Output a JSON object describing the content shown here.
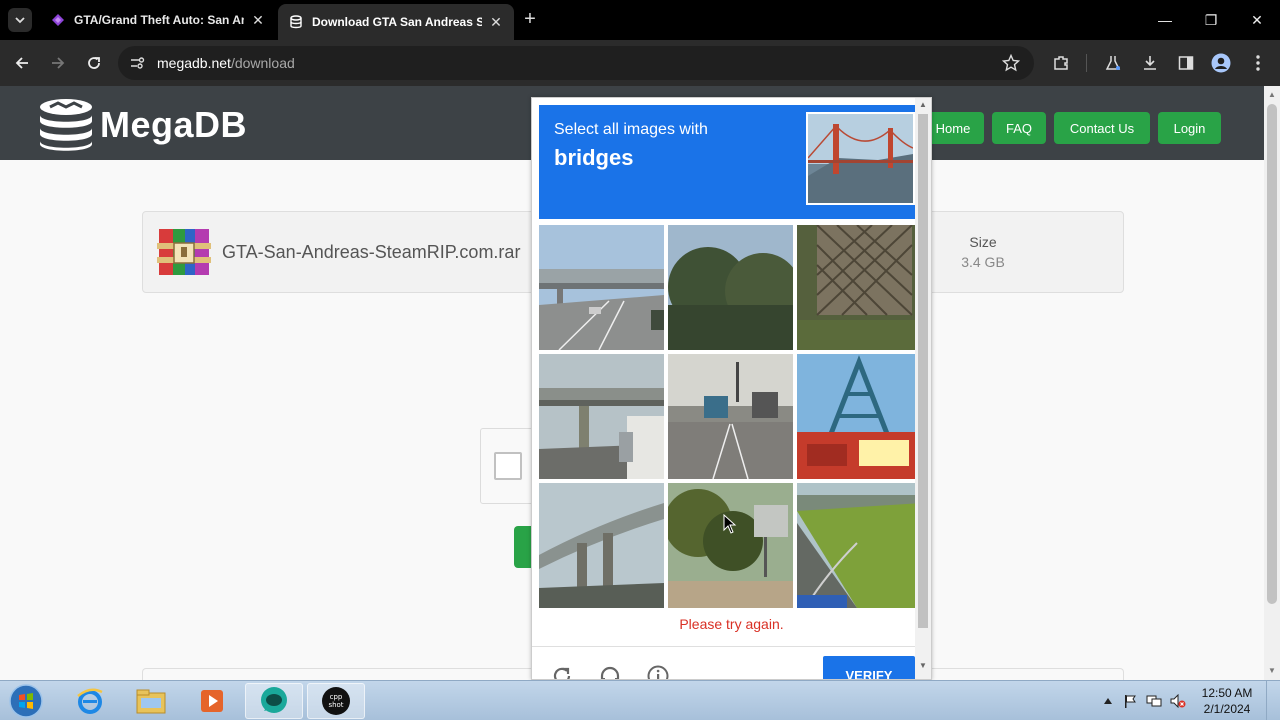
{
  "browser": {
    "tabs": [
      {
        "title": "GTA/Grand Theft Auto: San Andreas",
        "active": false
      },
      {
        "title": "Download GTA San Andreas SteamRIP",
        "active": true
      }
    ],
    "url": {
      "host": "megadb.net",
      "path": "/download"
    },
    "new_tab": "+",
    "close": "✕",
    "minimize": "—",
    "restore": "❐",
    "window_close": "✕"
  },
  "site": {
    "logo_text": "MegaDB",
    "nav": [
      "Home",
      "FAQ",
      "Contact Us",
      "Login"
    ],
    "file": {
      "name": "GTA-San-Andreas-SteamRIP.com.rar",
      "size_label": "Size",
      "size_value": "3.4 GB"
    }
  },
  "captcha": {
    "prompt": "Select all images with",
    "target": "bridges",
    "error": "Please try again.",
    "verify": "VERIFY",
    "tiles": [
      "highway-overpass",
      "tree-canopy",
      "lattice-fence",
      "overpass-truck",
      "road-trucks",
      "sign-tower",
      "elevated-ramp",
      "trees-sign",
      "road-field"
    ]
  },
  "taskbar": {
    "time": "12:50 AM",
    "date": "2/1/2024",
    "cpp_label": "cpp shot",
    "apps": [
      "internet-explorer",
      "file-explorer",
      "media-player",
      "chat-app",
      "cppshot"
    ]
  },
  "colors": {
    "accent_green": "#29a347",
    "captcha_blue": "#1a73e8",
    "header_dark": "#3d4246",
    "error_red": "#d93025"
  }
}
